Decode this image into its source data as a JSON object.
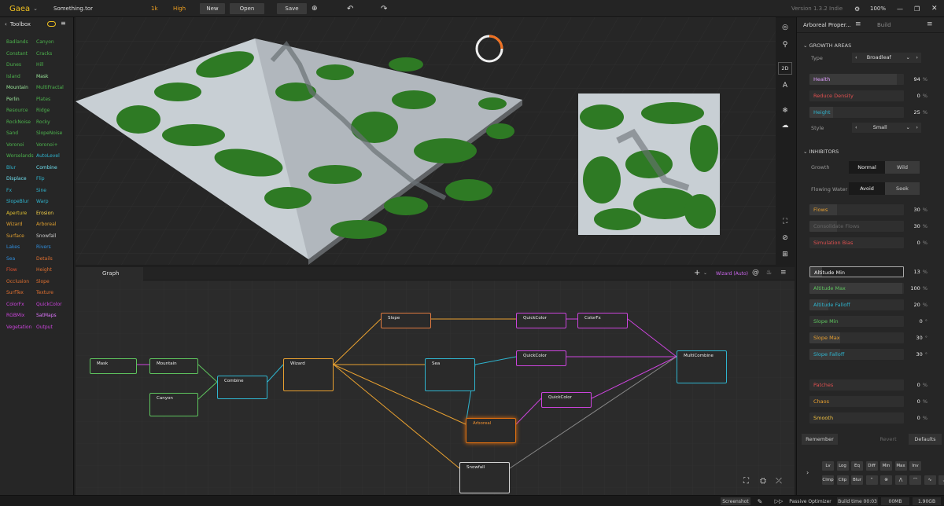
{
  "app": {
    "name": "Gaea",
    "file": "Something.tor",
    "resolution": "1k",
    "quality": "High",
    "version": "Version 1.3.2 Indie",
    "zoom": "100%"
  },
  "toolbar": {
    "new": "New",
    "open": "Open",
    "save": "Save"
  },
  "toolbox": {
    "title": "Toolbox",
    "items": [
      {
        "label": "Badlands",
        "color": "#4db34d"
      },
      {
        "label": "Canyon",
        "color": "#4db34d"
      },
      {
        "label": "Constant",
        "color": "#4db34d"
      },
      {
        "label": "Cracks",
        "color": "#4db34d"
      },
      {
        "label": "Dunes",
        "color": "#4db34d"
      },
      {
        "label": "Hill",
        "color": "#4db34d"
      },
      {
        "label": "Island",
        "color": "#4db34d"
      },
      {
        "label": "Mask",
        "color": "#9be89b"
      },
      {
        "label": "Mountain",
        "color": "#9be89b"
      },
      {
        "label": "MultiFractal",
        "color": "#4db34d"
      },
      {
        "label": "Perlin",
        "color": "#9be89b"
      },
      {
        "label": "Plates",
        "color": "#4db34d"
      },
      {
        "label": "Resource",
        "color": "#4db34d"
      },
      {
        "label": "Ridge",
        "color": "#4db34d"
      },
      {
        "label": "RockNoise",
        "color": "#4db34d"
      },
      {
        "label": "Rocky",
        "color": "#4db34d"
      },
      {
        "label": "Sand",
        "color": "#4db34d"
      },
      {
        "label": "SlopeNoise",
        "color": "#4db34d"
      },
      {
        "label": "Voronoi",
        "color": "#4db34d"
      },
      {
        "label": "Voronoi+",
        "color": "#4db34d"
      },
      {
        "label": "Worselands",
        "color": "#4db34d"
      },
      {
        "label": "AutoLevel",
        "color": "#2fb5cf"
      },
      {
        "label": "Blur",
        "color": "#2fb5cf"
      },
      {
        "label": "Combine",
        "color": "#6fe0f0"
      },
      {
        "label": "Displace",
        "color": "#6fe0f0"
      },
      {
        "label": "Flip",
        "color": "#2fb5cf"
      },
      {
        "label": "Fx",
        "color": "#2fb5cf"
      },
      {
        "label": "Sine",
        "color": "#2fb5cf"
      },
      {
        "label": "SlopeBlur",
        "color": "#2fb5cf"
      },
      {
        "label": "Warp",
        "color": "#2fb5cf"
      },
      {
        "label": "Aperture",
        "color": "#e0c030"
      },
      {
        "label": "Erosion",
        "color": "#ffd84a"
      },
      {
        "label": "Wizard",
        "color": "#e0a030"
      },
      {
        "label": "Arboreal",
        "color": "#e0a030"
      },
      {
        "label": "Surface",
        "color": "#e0a030"
      },
      {
        "label": "Snowfall",
        "color": "#cccccc"
      },
      {
        "label": "Lakes",
        "color": "#2f8fe0"
      },
      {
        "label": "Rivers",
        "color": "#2f8fe0"
      },
      {
        "label": "Sea",
        "color": "#2f8fe0"
      },
      {
        "label": "Details",
        "color": "#e07030"
      },
      {
        "label": "Flow",
        "color": "#e05030"
      },
      {
        "label": "Height",
        "color": "#e07030"
      },
      {
        "label": "Occlusion",
        "color": "#e07030"
      },
      {
        "label": "Slope",
        "color": "#e07030"
      },
      {
        "label": "SurfTex",
        "color": "#e07030"
      },
      {
        "label": "Texture",
        "color": "#e07030"
      },
      {
        "label": "ColorFx",
        "color": "#cc44dd"
      },
      {
        "label": "QuickColor",
        "color": "#cc44dd"
      },
      {
        "label": "RGBMix",
        "color": "#cc44dd"
      },
      {
        "label": "SatMaps",
        "color": "#e077ff"
      },
      {
        "label": "Vegetation",
        "color": "#cc44dd"
      },
      {
        "label": "Output",
        "color": "#cc44dd"
      }
    ]
  },
  "viewport_tools": {
    "mode_2d": "2D"
  },
  "graph": {
    "tab": "Graph",
    "mode": "Wizard (Auto)",
    "nodes": [
      {
        "label": "Mask",
        "color": "#5ec45e"
      },
      {
        "label": "Mountain",
        "color": "#5ec45e"
      },
      {
        "label": "Canyon",
        "color": "#5ec45e"
      },
      {
        "label": "Combine",
        "color": "#2fb5cf"
      },
      {
        "label": "Wizard",
        "color": "#e8a030"
      },
      {
        "label": "Slope",
        "color": "#e07a40"
      },
      {
        "label": "Sea",
        "color": "#2fb5cf"
      },
      {
        "label": "Arboreal",
        "color": "#e07010"
      },
      {
        "label": "Snowfall",
        "color": "#d8d8d8"
      },
      {
        "label": "QuickColor",
        "color": "#cc44dd"
      },
      {
        "label": "ColorFx",
        "color": "#cc44dd"
      },
      {
        "label": "QuickColor",
        "color": "#cc44dd"
      },
      {
        "label": "QuickColor",
        "color": "#cc44dd"
      },
      {
        "label": "MultiCombine",
        "color": "#2fb5cf"
      }
    ]
  },
  "properties": {
    "tab_title": "Arboreal Proper...",
    "tab_build": "Build",
    "growth_areas": "GROWTH AREAS",
    "type_label": "Type",
    "type_value": "Broadleaf",
    "health": {
      "label": "Health",
      "value": "94",
      "unit": "%",
      "fill": 0.94
    },
    "reduce_density": {
      "label": "Reduce Density",
      "value": "0",
      "unit": "%",
      "fill": 0
    },
    "height": {
      "label": "Height",
      "value": "25",
      "unit": "%",
      "fill": 0.25
    },
    "style_label": "Style",
    "style_value": "Small",
    "inhibitors": "INHIBITORS",
    "growth_label": "Growth",
    "growth_opts": [
      "Normal",
      "Wild"
    ],
    "flowing_label": "Flowing Water",
    "flowing_opts": [
      "Avoid",
      "Seek"
    ],
    "flows": {
      "label": "Flows",
      "value": "30",
      "unit": "%",
      "fill": 0.3
    },
    "consolidate": {
      "label": "Consolidate Flows",
      "value": "30",
      "unit": "%",
      "fill": 0.3
    },
    "sim_bias": {
      "label": "Simulation Bias",
      "value": "0",
      "unit": "%",
      "fill": 0
    },
    "alt_min": {
      "label": "Altitude Min",
      "value": "13",
      "unit": "%",
      "fill": 0.13
    },
    "alt_max": {
      "label": "Altitude Max",
      "value": "100",
      "unit": "%",
      "fill": 1.0
    },
    "alt_falloff": {
      "label": "Altitude Falloff",
      "value": "20",
      "unit": "%",
      "fill": 0.2
    },
    "slope_min": {
      "label": "Slope Min",
      "value": "0",
      "unit": "°",
      "fill": 0
    },
    "slope_max": {
      "label": "Slope Max",
      "value": "30",
      "unit": "°",
      "fill": 0.33
    },
    "slope_falloff": {
      "label": "Slope Falloff",
      "value": "30",
      "unit": "°",
      "fill": 0.33
    },
    "patches": {
      "label": "Patches",
      "value": "0",
      "unit": "%",
      "fill": 0
    },
    "chaos": {
      "label": "Chaos",
      "value": "0",
      "unit": "%",
      "fill": 0
    },
    "smooth": {
      "label": "Smooth",
      "value": "0",
      "unit": "%",
      "fill": 0
    },
    "remember": "Remember",
    "revert": "Revert",
    "defaults": "Defaults",
    "keys_row1": [
      "Lv",
      "Log",
      "Eq",
      "Diff",
      "Min",
      "Max",
      "Inv"
    ],
    "keys_row2": [
      "Clmp",
      "Clip",
      "Blur"
    ]
  },
  "status": {
    "screenshot": "Screenshot",
    "optimizer": "Passive Optimizer",
    "build_time": "Build time 00:03",
    "mem": "00MB",
    "disk": "1.90GB"
  }
}
